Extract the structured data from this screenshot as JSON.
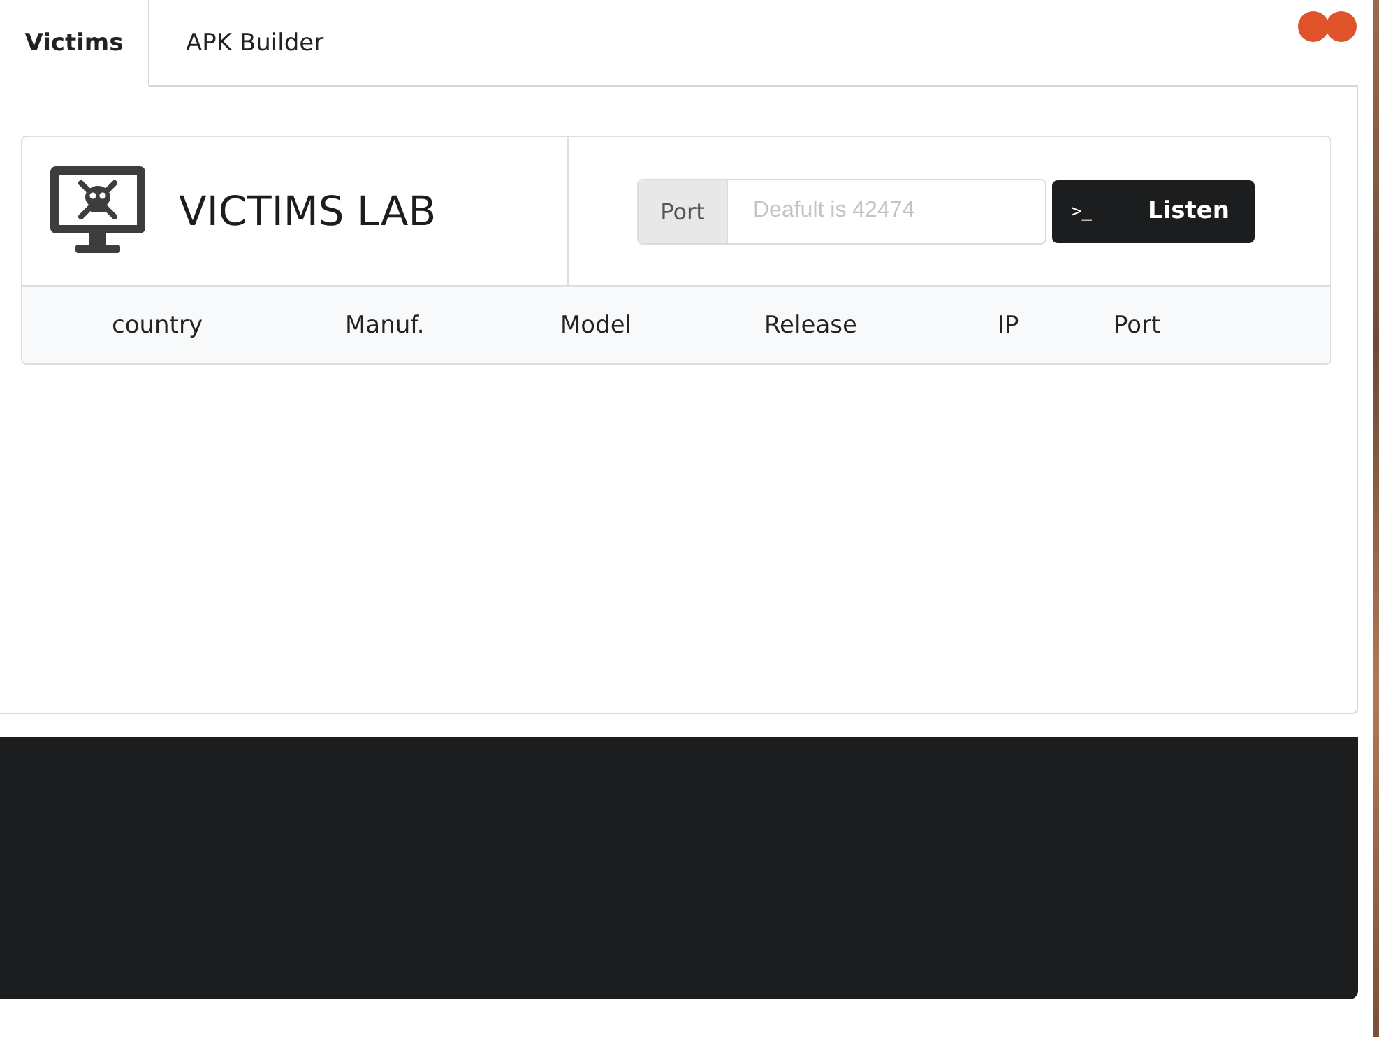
{
  "tabs": [
    {
      "label": "Victims",
      "selected": true
    },
    {
      "label": "APK Builder",
      "selected": false
    }
  ],
  "header": {
    "title": "VICTIMS LAB",
    "port_label": "Port",
    "port_field": {
      "placeholder": "Deafult is 42474"
    },
    "listen_button": {
      "icon": ">_",
      "label": "Listen"
    }
  },
  "table": {
    "columns": [
      "country",
      "Manuf.",
      "Model",
      "Release",
      "IP",
      "Port"
    ]
  }
}
